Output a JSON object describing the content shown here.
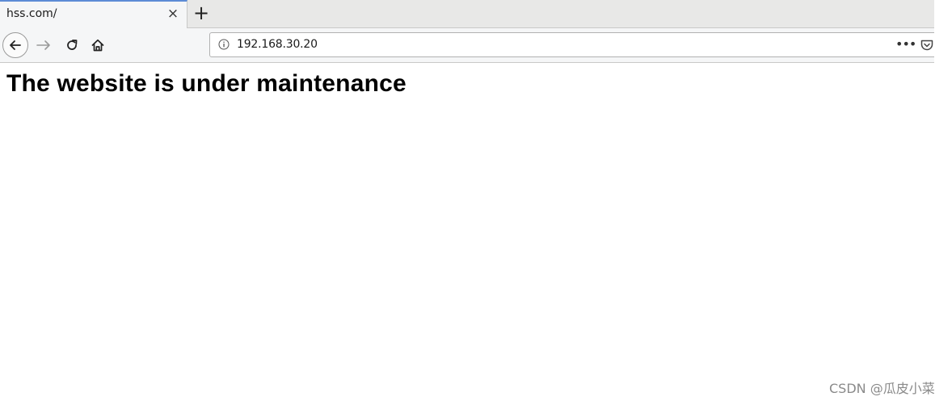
{
  "tabs": [
    {
      "title": "hss.com/",
      "close_glyph": "×"
    }
  ],
  "new_tab_glyph": "+",
  "navigation": {
    "back_icon": "arrow-left-icon",
    "forward_icon": "arrow-right-icon",
    "reload_icon": "reload-icon",
    "home_icon": "home-icon"
  },
  "urlbar": {
    "info_icon": "info-icon",
    "url": "192.168.30.20",
    "page_actions_glyph": "•••",
    "pocket_icon": "pocket-icon"
  },
  "page": {
    "heading": "The website is under maintenance"
  },
  "watermark": "CSDN @瓜皮小菜",
  "colors": {
    "tab_accent": "#5d8bd6",
    "toolbar_bg": "#f5f6f7",
    "tabstrip_bg": "#e8e8e7"
  }
}
